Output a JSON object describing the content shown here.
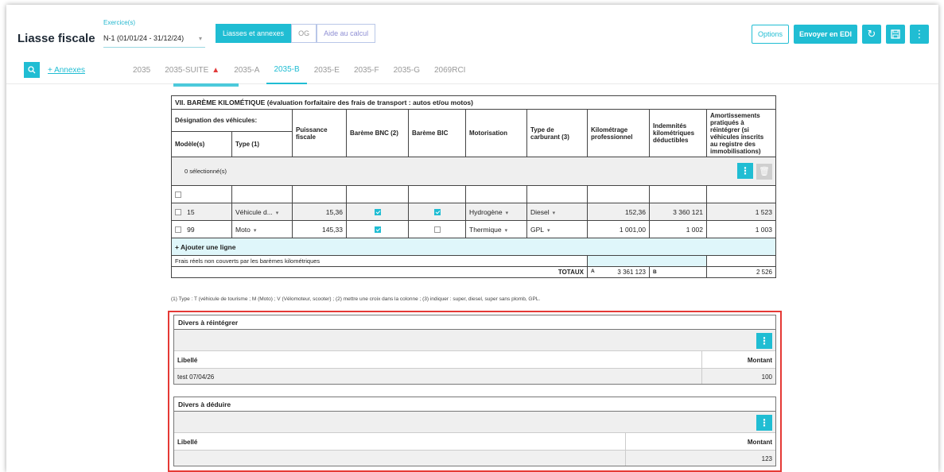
{
  "header": {
    "app_title": "Liasse fiscale",
    "exercise_label": "Exercice(s)",
    "exercise_value": "N-1 (01/01/24 - 31/12/24)",
    "segments": [
      "Liasses et annexes",
      "OG",
      "Aide au calcul"
    ],
    "options_label": "Options",
    "send_edi_label": "Envoyer en EDI"
  },
  "tabs": {
    "annexes_link": "+ Annexes",
    "items": [
      "2035",
      "2035-SUITE",
      "2035-A",
      "2035-B",
      "2035-E",
      "2035-F",
      "2035-G",
      "2069RCI"
    ],
    "active": "2035-B"
  },
  "bareme": {
    "title": "VII. BARÈME KILOMÉTIQUE (évaluation forfaitaire des frais de transport : autos et/ou motos)",
    "headers": {
      "designation": "Désignation des véhicules:",
      "modeles": "Modèle(s)",
      "type": "Type (1)",
      "puissance": "Puissance fiscale",
      "bnc": "Barème BNC (2)",
      "bic": "Barème BIC",
      "motorisation": "Motorisation",
      "carburant": "Type de carburant (3)",
      "km": "Kilométrage professionnel",
      "indemnites": "Indemnités kilométriques déductibles",
      "amort": "Amortissements pratiqués à réintégrer (si véhicules inscrits au registre des immobilisations)"
    },
    "selected_text": "0 sélectionné(s)",
    "rows": [
      {
        "modele": "15",
        "type": "Véhicule d...",
        "puissance": "15,36",
        "bnc": true,
        "bic": true,
        "motorisation": "Hydrogène",
        "carburant": "Diesel",
        "km": "152,36",
        "indemnites": "3 360 121",
        "amort": "1 523"
      },
      {
        "modele": "99",
        "type": "Moto",
        "puissance": "145,33",
        "bnc": true,
        "bic": false,
        "motorisation": "Thermique",
        "carburant": "GPL",
        "km": "1 001,00",
        "indemnites": "1 002",
        "amort": "1 003"
      }
    ],
    "add_line": "+ Ajouter une ligne",
    "frais_reels": "Frais réels non couverts par les barèmes kilométriques",
    "totaux_label": "TOTAUX",
    "total_a_label": "A",
    "total_a": "3 361 123",
    "total_b_label": "B",
    "total_b": "2 526",
    "note": "(1) Type : T (véhicule de tourisme ; M (Moto) ; V (Vélomoteur, scooter) ; (2) mettre une croix dans la colonne ; (3) indiquer : super, diesel, super sans plomb, GPL."
  },
  "divers_reintegrer": {
    "title": "Divers à réintégrer",
    "col_libelle": "Libellé",
    "col_montant": "Montant",
    "rows": [
      {
        "libelle": "test 07/04/26",
        "montant": "100"
      }
    ]
  },
  "divers_deduire": {
    "title": "Divers à déduire",
    "col_libelle": "Libellé",
    "col_montant": "Montant",
    "rows": [
      {
        "libelle": "",
        "montant": "123"
      }
    ]
  },
  "colors": {
    "accent": "#20bdd3",
    "highlight": "#e53935"
  }
}
